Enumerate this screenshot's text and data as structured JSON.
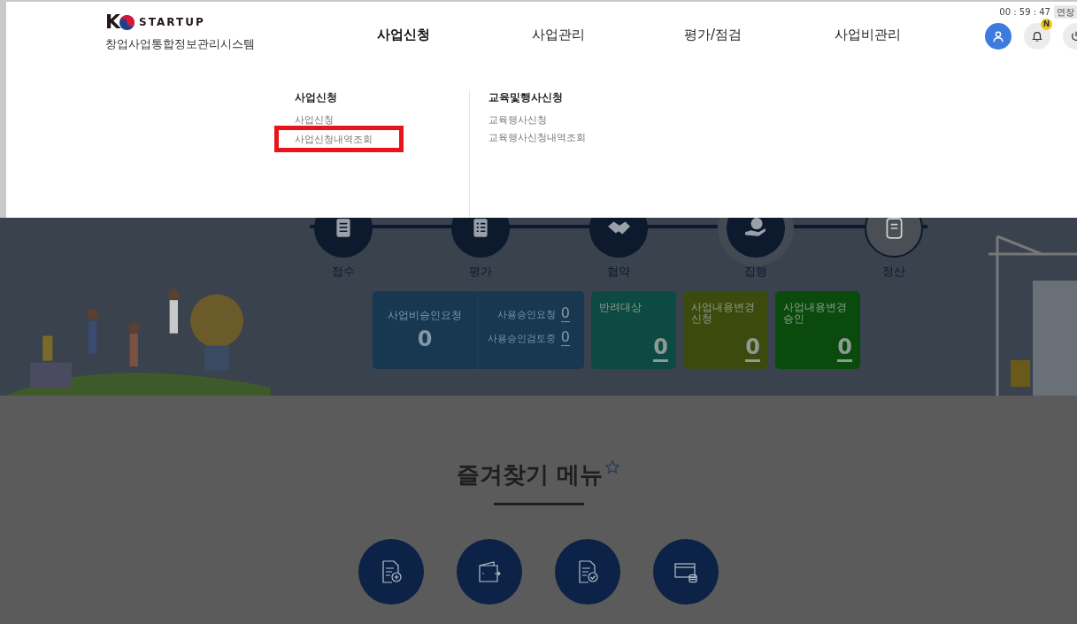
{
  "header": {
    "logo": {
      "letter": "K",
      "word": "STARTUP"
    },
    "subtitle": "창업사업통합정보관리시스템",
    "nav": [
      {
        "label": "사업신청",
        "selected": true
      },
      {
        "label": "사업관리",
        "selected": false
      },
      {
        "label": "평가/점검",
        "selected": false
      },
      {
        "label": "사업비관리",
        "selected": false
      }
    ],
    "timer": "00 : 59 : 47",
    "extend_button": "연장",
    "notification_badge": "N"
  },
  "dropdown": {
    "groups": [
      {
        "title": "사업신청",
        "items": [
          {
            "label": "사업신청",
            "highlighted": false
          },
          {
            "label": "사업신청내역조회",
            "highlighted": true
          }
        ]
      },
      {
        "title": "교육및행사신청",
        "items": [
          {
            "label": "교육행사신청",
            "highlighted": false
          },
          {
            "label": "교육행사신청내역조회",
            "highlighted": false
          }
        ]
      }
    ]
  },
  "steps": [
    {
      "label": "접수",
      "done": true,
      "current": false
    },
    {
      "label": "평가",
      "done": true,
      "current": false
    },
    {
      "label": "협약",
      "done": true,
      "current": false
    },
    {
      "label": "집행",
      "done": true,
      "current": true
    },
    {
      "label": "정산",
      "done": false,
      "current": false
    }
  ],
  "summary": {
    "main": {
      "title": "사업비승인요청",
      "count": "0",
      "sub": [
        {
          "label": "사용승인요청",
          "count": "0"
        },
        {
          "label": "사용승인검토중",
          "count": "0"
        }
      ]
    },
    "cards": [
      {
        "title": "반려대상",
        "count": "0",
        "color": "#0e4a44"
      },
      {
        "title": "사업내용변경신청",
        "count": "0",
        "color": "#3c4a0e"
      },
      {
        "title": "사업내용변경승인",
        "count": "0",
        "color": "#0b4a0d"
      }
    ]
  },
  "favorites": {
    "title": "즐겨찾기 메뉴",
    "items": [
      {
        "kind": "doc-plus"
      },
      {
        "kind": "wallet"
      },
      {
        "kind": "doc-check"
      },
      {
        "kind": "card-coins"
      }
    ]
  }
}
